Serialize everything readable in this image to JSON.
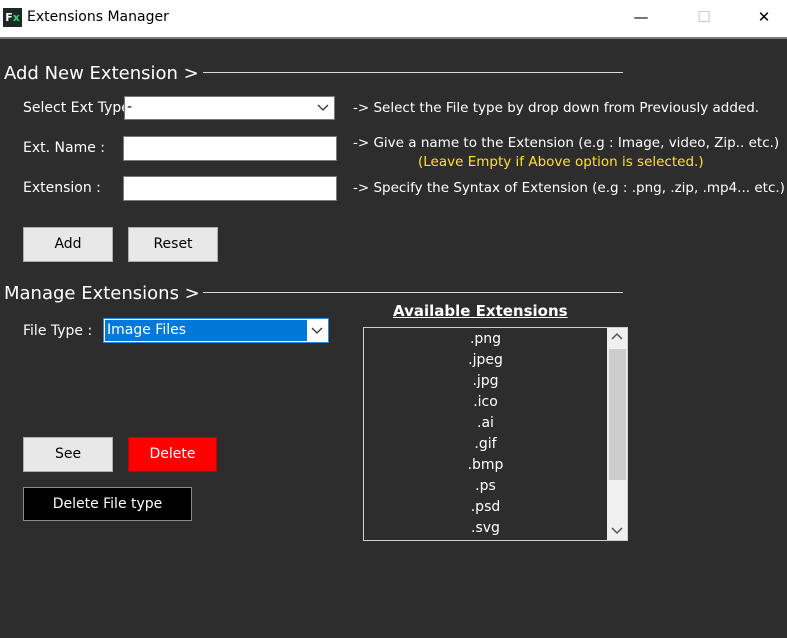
{
  "window": {
    "title": "Extensions Manager",
    "icon_text_left": "F",
    "icon_text_right": "x",
    "minimize_glyph": "—",
    "maximize_glyph": "☐",
    "close_glyph": "✕"
  },
  "add_section": {
    "title": "Add New Extension >",
    "select_ext_type_label": "Select Ext Type",
    "select_ext_type_value": "-",
    "select_ext_type_hint": "-> Select the File type by drop down from Previously added.",
    "ext_name_label": "Ext. Name :",
    "ext_name_value": "",
    "ext_name_hint": "-> Give a name to the Extension (e.g : Image, video, Zip.. etc.)",
    "ext_name_note": "(Leave Empty if Above option is selected.)",
    "extension_label": "Extension :",
    "extension_value": "",
    "extension_hint": "-> Specify the Syntax of Extension (e.g : .png, .zip, .mp4... etc.)",
    "add_button": "Add",
    "reset_button": "Reset"
  },
  "manage_section": {
    "title": "Manage Extensions >",
    "file_type_label": "File Type :",
    "file_type_value": "Image Files",
    "see_button": "See",
    "delete_button": "Delete",
    "delete_file_type_button": "Delete File type",
    "available_title": "Available Extensions",
    "extensions": [
      ".png",
      ".jpeg",
      ".jpg",
      ".ico",
      ".ai",
      ".gif",
      ".bmp",
      ".ps",
      ".psd",
      ".svg"
    ]
  },
  "colors": {
    "background": "#2d2d2d",
    "highlight": "#0078d7",
    "delete": "#ff0000",
    "note": "#ffe030"
  }
}
